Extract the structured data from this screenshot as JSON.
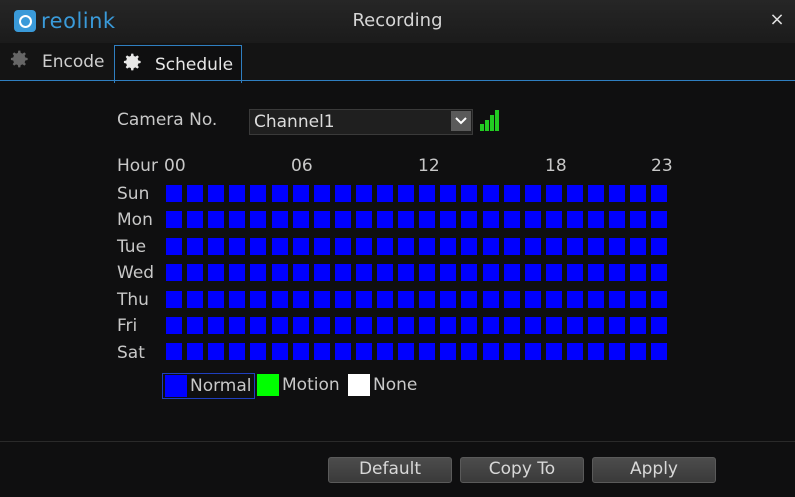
{
  "window": {
    "logo_text": "reolink",
    "title": "Recording",
    "close_glyph": "×"
  },
  "tabs": [
    {
      "label": "Encode",
      "icon": "gear-icon",
      "active": false
    },
    {
      "label": "Schedule",
      "icon": "gear-icon",
      "active": true
    }
  ],
  "camera": {
    "label": "Camera No.",
    "value": "Channel1"
  },
  "schedule": {
    "hour_label": "Hour",
    "hour_ticks": [
      "00",
      "06",
      "12",
      "18",
      "23"
    ],
    "days": [
      "Sun",
      "Mon",
      "Tue",
      "Wed",
      "Thu",
      "Fri",
      "Sat"
    ],
    "hours_per_day": 24,
    "mode_all": "Normal"
  },
  "legend": [
    {
      "label": "Normal",
      "color": "#0000ff"
    },
    {
      "label": "Motion",
      "color": "#00ff00"
    },
    {
      "label": "None",
      "color": "#ffffff"
    }
  ],
  "colors": {
    "accent": "#2f7fc1",
    "signal": "#22cc22"
  },
  "buttons": {
    "default": "Default",
    "copy_to": "Copy To",
    "apply": "Apply"
  }
}
